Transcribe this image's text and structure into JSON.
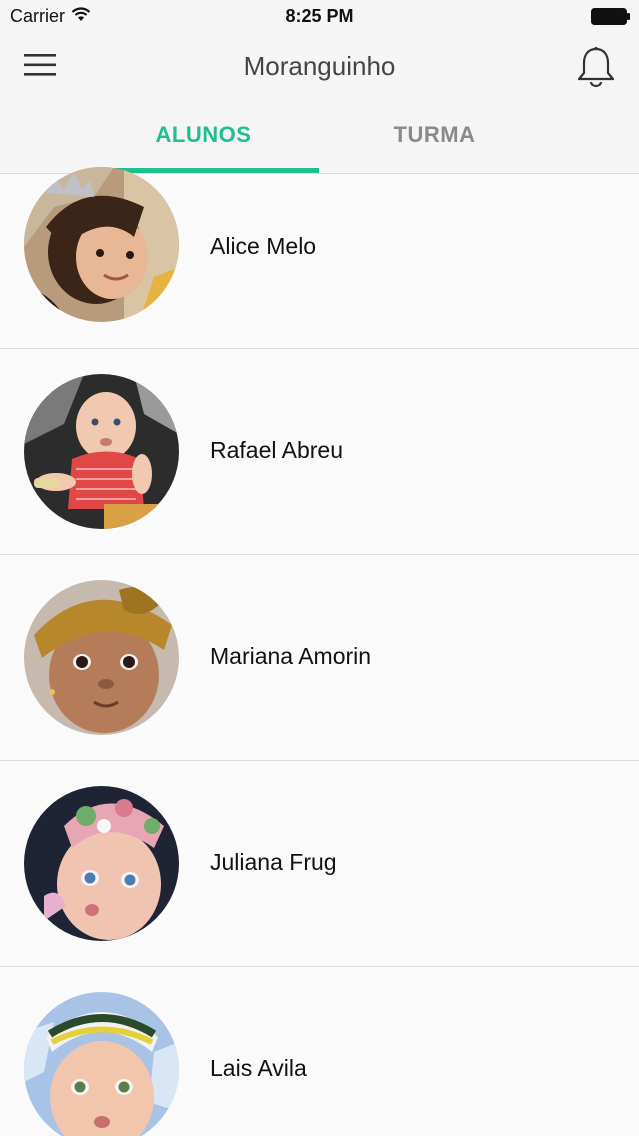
{
  "status_bar": {
    "carrier": "Carrier",
    "time": "8:25 PM"
  },
  "header": {
    "title": "Moranguinho",
    "menu_icon": "hamburger-menu-icon",
    "notification_icon": "bell-icon"
  },
  "tabs": [
    {
      "label": "ALUNOS",
      "active": true
    },
    {
      "label": "TURMA",
      "active": false
    }
  ],
  "colors": {
    "accent": "#1fbf8f",
    "inactive_tab": "#8a8a8a"
  },
  "students": [
    {
      "name": "Alice Melo"
    },
    {
      "name": "Rafael Abreu"
    },
    {
      "name": "Mariana Amorin"
    },
    {
      "name": "Juliana Frug"
    },
    {
      "name": "Lais Avila"
    }
  ]
}
